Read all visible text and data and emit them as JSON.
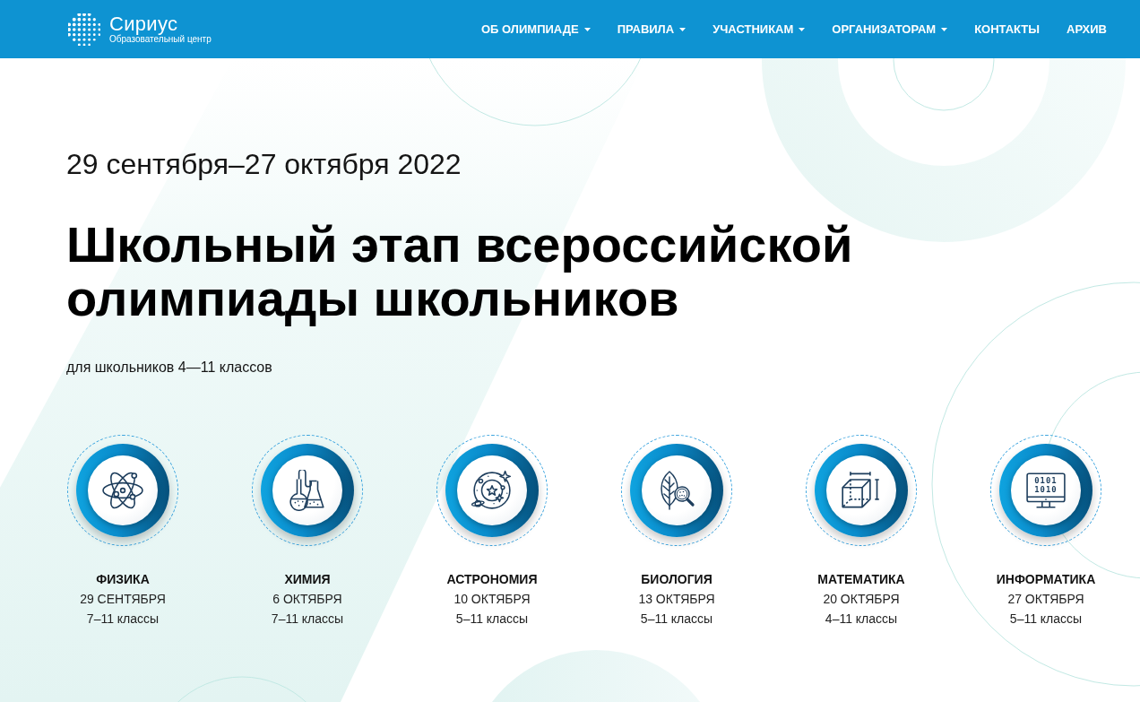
{
  "header": {
    "logo_title": "Сириус",
    "logo_subtitle": "Образовательный центр",
    "nav": [
      {
        "label": "ОБ ОЛИМПИАДЕ",
        "dropdown": true
      },
      {
        "label": "ПРАВИЛА",
        "dropdown": true
      },
      {
        "label": "УЧАСТНИКАМ",
        "dropdown": true
      },
      {
        "label": "ОРГАНИЗАТОРАМ",
        "dropdown": true
      },
      {
        "label": "КОНТАКТЫ",
        "dropdown": false
      },
      {
        "label": "АРХИВ",
        "dropdown": false
      }
    ]
  },
  "hero": {
    "dates": "29 сентября–27 октября 2022",
    "title": "Школьный этап всероссийской олимпиады школьников",
    "audience": "для школьников 4—11 классов"
  },
  "subjects": [
    {
      "name": "ФИЗИКА",
      "date": "29 СЕНТЯБРЯ",
      "grades": "7–11 классы"
    },
    {
      "name": "ХИМИЯ",
      "date": "6 ОКТЯБРЯ",
      "grades": "7–11 классы"
    },
    {
      "name": "АСТРОНОМИЯ",
      "date": "10 ОКТЯБРЯ",
      "grades": "5–11 классы"
    },
    {
      "name": "БИОЛОГИЯ",
      "date": "13 ОКТЯБРЯ",
      "grades": "5–11 классы"
    },
    {
      "name": "МАТЕМАТИКА",
      "date": "20 ОКТЯБРЯ",
      "grades": "4–11 классы"
    },
    {
      "name": "ИНФОРМАТИКА",
      "date": "27 ОКТЯБРЯ",
      "grades": "5–11 классы",
      "screen_text": [
        "0101",
        "1010"
      ]
    }
  ]
}
